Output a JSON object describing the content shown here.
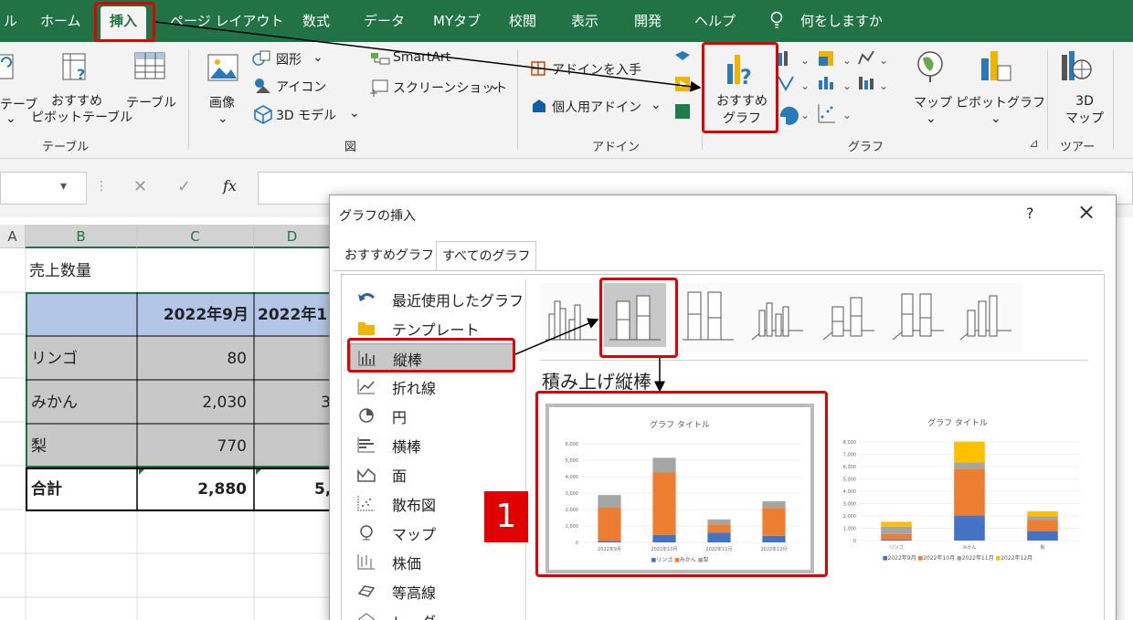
{
  "menu": {
    "items": [
      "ル",
      "ホーム",
      "挿入",
      "ページ レイアウト",
      "数式",
      "データ",
      "MYタブ",
      "校閲",
      "表示",
      "開発",
      "ヘルプ",
      "何をしますか"
    ]
  },
  "ribbon": {
    "table_group": {
      "pivot_partial": "テーブ",
      "recommended_pivot": "おすすめ\nピボットテーブル",
      "table": "テーブル",
      "label": "テーブル"
    },
    "illustrations": {
      "image": "画像",
      "shapes": "図形",
      "icons": "アイコン",
      "models3d": "3D モデル",
      "smartart": "SmartArt",
      "screenshot": "スクリーンショット",
      "label": "図"
    },
    "addins": {
      "get": "アドインを入手",
      "personal": "個人用アドイン",
      "label": "アドイン"
    },
    "charts": {
      "recommended": "おすすめ\nグラフ",
      "map": "マップ",
      "pivot_chart": "ピボットグラフ",
      "label": "グラフ"
    },
    "tours": {
      "map3d": "3D\nマップ",
      "label": "ツアー"
    }
  },
  "formula_bar": {
    "fx": "fx"
  },
  "sheet": {
    "columns": [
      "A",
      "B",
      "C",
      "D"
    ],
    "title": "売上数量",
    "header": [
      "2022年9月",
      "2022年1"
    ],
    "rows": [
      {
        "label": "リンゴ",
        "c": "80",
        "d": ""
      },
      {
        "label": "みかん",
        "c": "2,030",
        "d": "3"
      },
      {
        "label": "梨",
        "c": "770",
        "d": ""
      }
    ],
    "total": {
      "label": "合計",
      "c": "2,880",
      "d": "5,"
    }
  },
  "dialog": {
    "title": "グラフの挿入",
    "help": "?",
    "close": "×",
    "tabs": [
      "おすすめグラフ",
      "すべてのグラフ"
    ],
    "categories": [
      "最近使用したグラフ",
      "テンプレート",
      "縦棒",
      "折れ線",
      "円",
      "横棒",
      "面",
      "散布図",
      "マップ",
      "株価",
      "等高線",
      "レーダー"
    ],
    "selected_category": "縦棒",
    "subtype_title": "積み上げ縦棒",
    "marker": "1",
    "preview": {
      "title": "グラフ タイトル",
      "y_ticks_left": [
        "6,000",
        "5,000",
        "4,000",
        "3,000",
        "2,000",
        "1,000",
        "0"
      ],
      "y_ticks_right": [
        "8,000",
        "7,000",
        "6,000",
        "5,000",
        "4,000",
        "3,000",
        "2,000",
        "1,000",
        "0"
      ],
      "x_left": [
        "2022年9月",
        "2022年10月",
        "2022年11月",
        "2022年12月"
      ],
      "x_right": [
        "リンゴ",
        "みかん",
        "梨"
      ],
      "legend_left": [
        "リンゴ",
        "みかん",
        "梨"
      ],
      "legend_right": [
        "2022年9月",
        "2022年10月",
        "2022年11月",
        "2022年12月"
      ]
    }
  },
  "colors": {
    "excel_green": "#217346",
    "highlight_red": "#e00000",
    "series_blue": "#4472c4",
    "series_orange": "#ed7d31",
    "series_gray": "#a5a5a5",
    "series_yellow": "#ffc000"
  }
}
